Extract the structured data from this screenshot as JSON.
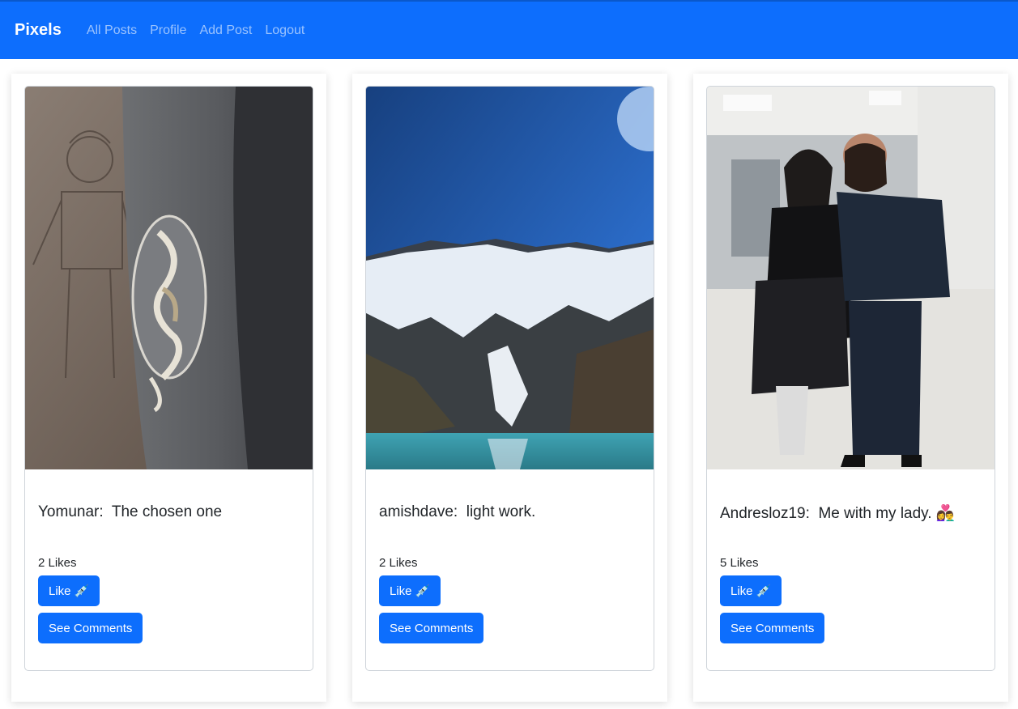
{
  "navbar": {
    "brand": "Pixels",
    "links": [
      "All Posts",
      "Profile",
      "Add Post",
      "Logout"
    ],
    "color": "#0d6efd"
  },
  "posts": [
    {
      "author": "Yomunar:",
      "text": "The chosen one",
      "likes": "2 Likes",
      "like_label": "Like 💉",
      "comments_label": "See Comments",
      "image": "photo of an embroidered dragon on a leather bag"
    },
    {
      "author": "amishdave:",
      "text": "light work.",
      "likes": "2 Likes",
      "like_label": "Like 💉",
      "comments_label": "See Comments",
      "image": "photo of snowy mountains above a turquoise lake"
    },
    {
      "author": "Andresloz19:",
      "text": "Me with my lady. 👩‍❤️‍👨",
      "likes": "5 Likes",
      "like_label": "Like 💉",
      "comments_label": "See Comments",
      "image": "photo of a couple standing in an airport hallway"
    }
  ]
}
